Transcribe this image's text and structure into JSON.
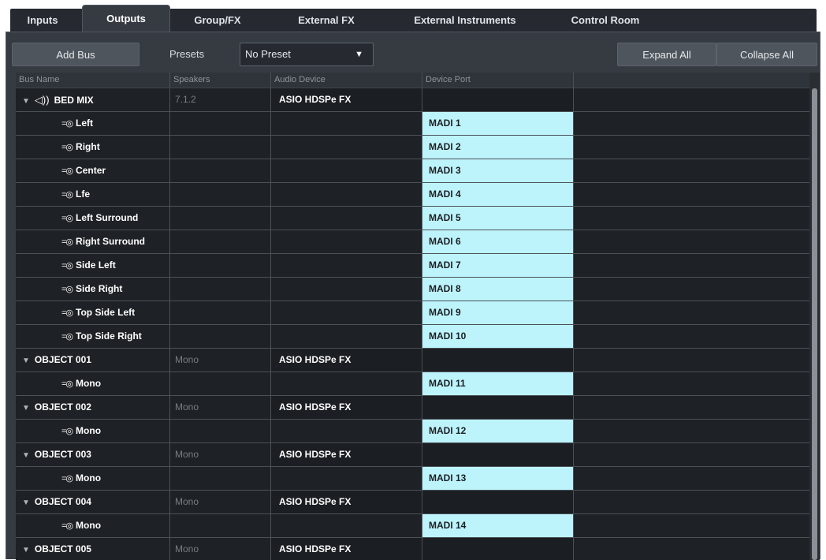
{
  "tabs": [
    {
      "label": "Inputs",
      "active": false
    },
    {
      "label": "Outputs",
      "active": true
    },
    {
      "label": "Group/FX",
      "active": false
    },
    {
      "label": "External FX",
      "active": false
    },
    {
      "label": "External Instruments",
      "active": false
    },
    {
      "label": "Control Room",
      "active": false
    }
  ],
  "toolbar": {
    "add_bus_label": "Add Bus",
    "presets_label": "Presets",
    "preset_value": "No Preset",
    "expand_all_label": "Expand All",
    "collapse_all_label": "Collapse All"
  },
  "columns": [
    "Bus Name",
    "Speakers",
    "Audio Device",
    "Device Port"
  ],
  "rows": [
    {
      "type": "parent",
      "icon": "speaker-icon",
      "name": "BED MIX",
      "speakers": "7.1.2",
      "device": "ASIO HDSPe FX",
      "port": ""
    },
    {
      "type": "child",
      "icon": "channel-icon",
      "name": "Left",
      "speakers": "",
      "device": "",
      "port": "MADI 1"
    },
    {
      "type": "child",
      "icon": "channel-icon",
      "name": "Right",
      "speakers": "",
      "device": "",
      "port": "MADI 2"
    },
    {
      "type": "child",
      "icon": "channel-icon",
      "name": "Center",
      "speakers": "",
      "device": "",
      "port": "MADI 3"
    },
    {
      "type": "child",
      "icon": "channel-icon",
      "name": "Lfe",
      "speakers": "",
      "device": "",
      "port": "MADI 4"
    },
    {
      "type": "child",
      "icon": "channel-icon",
      "name": "Left Surround",
      "speakers": "",
      "device": "",
      "port": "MADI 5"
    },
    {
      "type": "child",
      "icon": "channel-icon",
      "name": "Right Surround",
      "speakers": "",
      "device": "",
      "port": "MADI 6"
    },
    {
      "type": "child",
      "icon": "channel-icon",
      "name": "Side Left",
      "speakers": "",
      "device": "",
      "port": "MADI 7"
    },
    {
      "type": "child",
      "icon": "channel-icon",
      "name": "Side Right",
      "speakers": "",
      "device": "",
      "port": "MADI 8"
    },
    {
      "type": "child",
      "icon": "channel-icon",
      "name": "Top Side Left",
      "speakers": "",
      "device": "",
      "port": "MADI 9"
    },
    {
      "type": "child",
      "icon": "channel-icon",
      "name": "Top Side Right",
      "speakers": "",
      "device": "",
      "port": "MADI 10"
    },
    {
      "type": "parent",
      "icon": "",
      "name": "OBJECT 001",
      "speakers": "Mono",
      "device": "ASIO HDSPe FX",
      "port": ""
    },
    {
      "type": "child",
      "icon": "channel-icon",
      "name": "Mono",
      "speakers": "",
      "device": "",
      "port": "MADI 11"
    },
    {
      "type": "parent",
      "icon": "",
      "name": "OBJECT 002",
      "speakers": "Mono",
      "device": "ASIO HDSPe FX",
      "port": ""
    },
    {
      "type": "child",
      "icon": "channel-icon",
      "name": "Mono",
      "speakers": "",
      "device": "",
      "port": "MADI 12"
    },
    {
      "type": "parent",
      "icon": "",
      "name": "OBJECT 003",
      "speakers": "Mono",
      "device": "ASIO HDSPe FX",
      "port": ""
    },
    {
      "type": "child",
      "icon": "channel-icon",
      "name": "Mono",
      "speakers": "",
      "device": "",
      "port": "MADI 13"
    },
    {
      "type": "parent",
      "icon": "",
      "name": "OBJECT 004",
      "speakers": "Mono",
      "device": "ASIO HDSPe FX",
      "port": ""
    },
    {
      "type": "child",
      "icon": "channel-icon",
      "name": "Mono",
      "speakers": "",
      "device": "",
      "port": "MADI 14"
    },
    {
      "type": "parent",
      "icon": "",
      "name": "OBJECT 005",
      "speakers": "Mono",
      "device": "ASIO HDSPe FX",
      "port": ""
    }
  ],
  "colors": {
    "port_assigned": "#bdf4fb",
    "panel": "#363b42",
    "grid": "#1e2226"
  }
}
